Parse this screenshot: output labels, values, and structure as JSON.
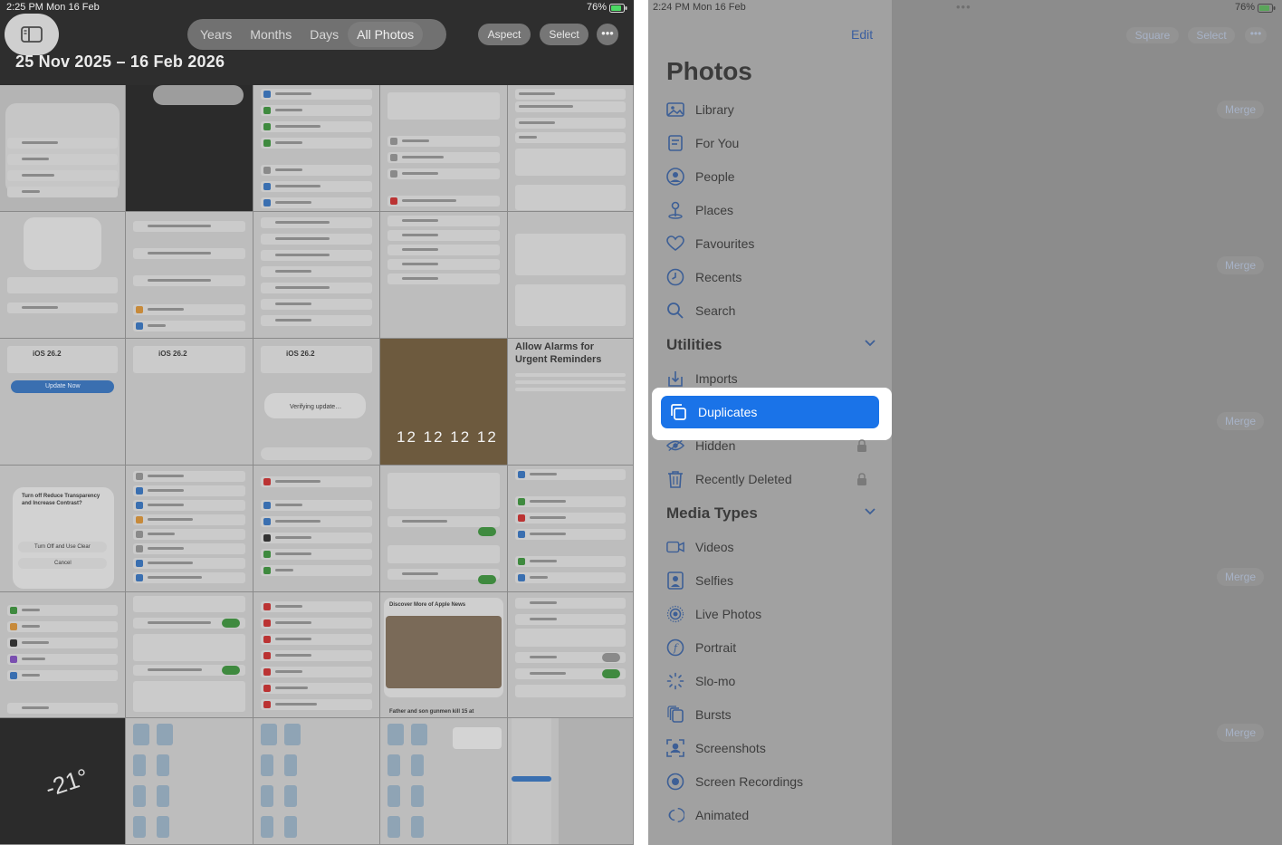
{
  "left": {
    "status": {
      "time": "2:25 PM  Mon 16 Feb",
      "battery": "76%"
    },
    "segments": [
      "Years",
      "Months",
      "Days",
      "All Photos"
    ],
    "active_segment": "All Photos",
    "aspect_label": "Aspect",
    "select_label": "Select",
    "more_label": "•••",
    "date_range": "25 Nov 2025 – 16 Feb 2026",
    "thumbnails": {
      "alarms_title": "Allow Alarms for Urgent Reminders",
      "ios_version_1": "iOS 26.2",
      "ios_version_2": "iOS 26.2",
      "ios_version_3": "iOS 26.2",
      "update_now": "Update Now",
      "verifying": "Verifying update…",
      "lock_digits": "12 12 12 12",
      "temperature": "-21°",
      "news_title": "Discover More of Apple News",
      "news_headline": "Father and son gunmen kill 15 at",
      "reduce_transparency_title": "Turn off Reduce Transparency and Increase Contrast?",
      "turn_off_clear": "Turn Off and Use Clear",
      "cancel": "Cancel"
    }
  },
  "right": {
    "status": {
      "time": "2:24 PM  Mon 16 Feb",
      "dots": "•••",
      "battery": "76%"
    },
    "edit_label": "Edit",
    "title": "Photos",
    "library_items": [
      {
        "label": "Library",
        "icon": "library-icon"
      },
      {
        "label": "For You",
        "icon": "for-you-icon"
      },
      {
        "label": "People",
        "icon": "people-icon"
      },
      {
        "label": "Places",
        "icon": "places-icon"
      },
      {
        "label": "Favourites",
        "icon": "heart-icon"
      },
      {
        "label": "Recents",
        "icon": "clock-icon"
      },
      {
        "label": "Search",
        "icon": "search-icon"
      }
    ],
    "utilities": {
      "header": "Utilities",
      "items": [
        {
          "label": "Imports",
          "icon": "imports-icon"
        },
        {
          "label": "Duplicates",
          "icon": "duplicates-icon",
          "selected": true
        },
        {
          "label": "Hidden",
          "icon": "hidden-icon",
          "locked": true
        },
        {
          "label": "Recently Deleted",
          "icon": "trash-icon",
          "locked": true
        }
      ]
    },
    "media_types": {
      "header": "Media Types",
      "items": [
        {
          "label": "Videos",
          "icon": "video-icon"
        },
        {
          "label": "Selfies",
          "icon": "selfie-icon"
        },
        {
          "label": "Live Photos",
          "icon": "live-photo-icon"
        },
        {
          "label": "Portrait",
          "icon": "portrait-icon"
        },
        {
          "label": "Slo-mo",
          "icon": "slomo-icon"
        },
        {
          "label": "Bursts",
          "icon": "bursts-icon"
        },
        {
          "label": "Screenshots",
          "icon": "screenshot-icon"
        },
        {
          "label": "Screen Recordings",
          "icon": "screen-recording-icon"
        },
        {
          "label": "Animated",
          "icon": "animated-icon"
        }
      ]
    },
    "square_label": "Square",
    "select_label": "Select",
    "more_label": "•••",
    "merge_label": "Merge",
    "colors": {
      "accent": "#1a73e8",
      "highlight": "#ffffff"
    }
  }
}
